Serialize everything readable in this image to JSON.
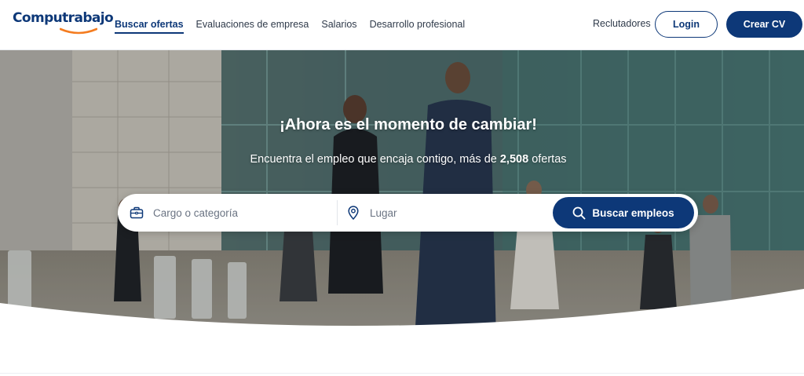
{
  "header": {
    "logo": "Computrabajo",
    "nav": [
      "Buscar ofertas",
      "Evaluaciones de empresa",
      "Salarios",
      "Desarrollo profesional"
    ],
    "active_nav_index": 0,
    "recruiters": "Reclutadores",
    "login": "Login",
    "create_cv": "Crear CV"
  },
  "hero": {
    "title": "¡Ahora es el momento de cambiar!",
    "subtitle_prefix": "Encuentra el empleo que encaja contigo, más de",
    "offers_count": "2,508",
    "subtitle_suffix": "ofertas"
  },
  "search": {
    "job_placeholder": "Cargo o categoría",
    "job_icon": "briefcase-icon",
    "location_placeholder": "Lugar",
    "location_icon": "location-pin-icon",
    "button_label": "Buscar empleos",
    "button_icon": "search-icon"
  },
  "colors": {
    "brand": "#0d3878",
    "accent": "#f47c20"
  }
}
